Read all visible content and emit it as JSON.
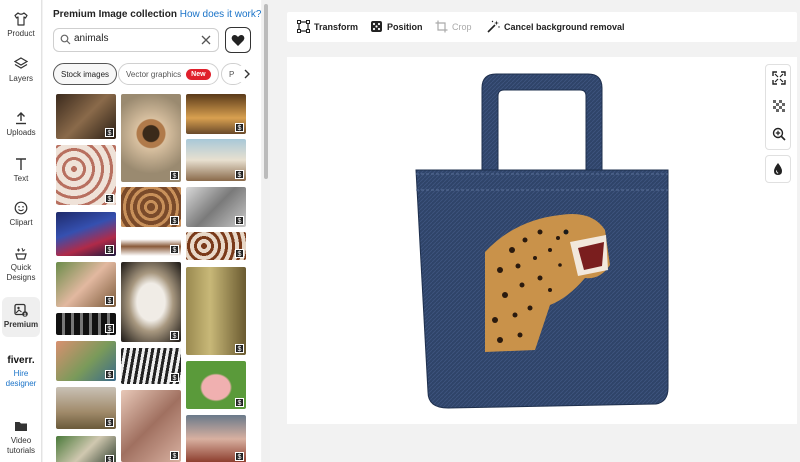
{
  "rail": {
    "product": "Product",
    "layers": "Layers",
    "uploads": "Uploads",
    "text": "Text",
    "clipart": "Clipart",
    "quick_designs": "Quick Designs",
    "premium": "Premium",
    "fiverr_logo": "fiverr.",
    "hire_designer": "Hire designer",
    "video_tutorials": "Video tutorials"
  },
  "panel": {
    "title": "Premium Image collection",
    "help_link": "How does it work?",
    "search_value": "animals",
    "chips": {
      "stock": "Stock images",
      "vector": "Vector graphics",
      "vector_badge": "New",
      "partial": "P"
    },
    "price_badge": "$"
  },
  "toolbar": {
    "transform": "Transform",
    "position": "Position",
    "crop": "Crop",
    "cancel_bg": "Cancel background removal"
  },
  "colors": {
    "accent": "#1a73c8",
    "badge_red": "#e0202c",
    "denim": "#2f4469"
  }
}
